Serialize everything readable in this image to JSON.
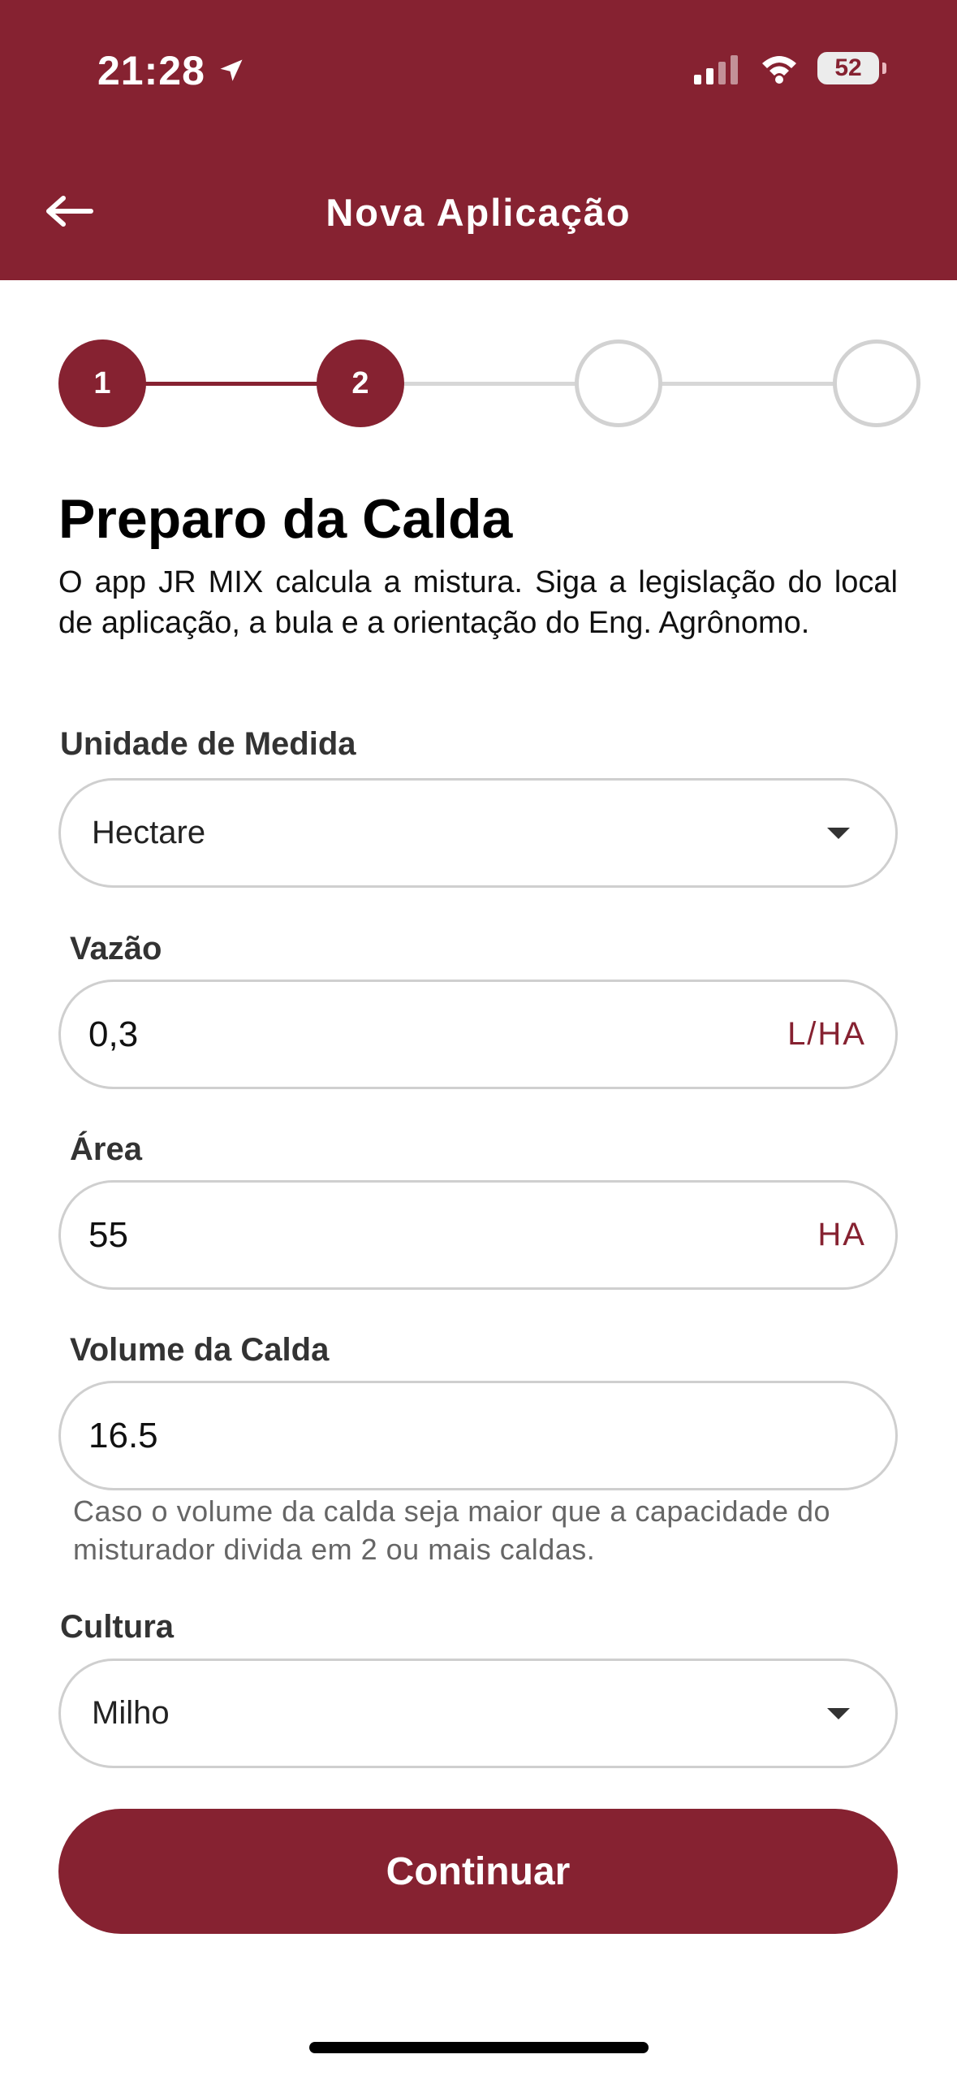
{
  "status_bar": {
    "time": "21:28",
    "battery": "52",
    "icons": [
      "location-arrow-icon",
      "cellular-signal-icon",
      "wifi-icon",
      "battery-icon"
    ]
  },
  "header": {
    "title": "Nova Aplicação",
    "back_icon": "arrow-left-icon"
  },
  "stepper": {
    "current_step": 2,
    "total_steps": 4,
    "steps": [
      {
        "label": "1",
        "state": "active"
      },
      {
        "label": "2",
        "state": "active"
      },
      {
        "label": "",
        "state": "inactive"
      },
      {
        "label": "",
        "state": "inactive"
      }
    ]
  },
  "main": {
    "section_title": "Preparo da Calda",
    "description": "O app JR MIX calcula a mistura. Siga a legislação do local de aplicação, a bula e a orientação do Eng. Agrônomo."
  },
  "form": {
    "unit_measure": {
      "label": "Unidade de Medida",
      "value": "Hectare"
    },
    "flow_rate": {
      "label": "Vazão",
      "value": "0,3",
      "unit": "L/HA"
    },
    "area": {
      "label": "Área",
      "value": "55",
      "unit": "HA"
    },
    "spray_volume": {
      "label": "Volume da Calda",
      "value": "16.5",
      "hint": "Caso o volume da calda seja maior que a capacidade do misturador divida em 2 ou mais caldas."
    },
    "crop": {
      "label": "Cultura",
      "value": "Milho"
    }
  },
  "actions": {
    "continue_label": "Continuar"
  },
  "colors": {
    "primary": "#862231",
    "inactive_step": "#d2d2d2",
    "text": "#111111",
    "hint": "#666666"
  }
}
